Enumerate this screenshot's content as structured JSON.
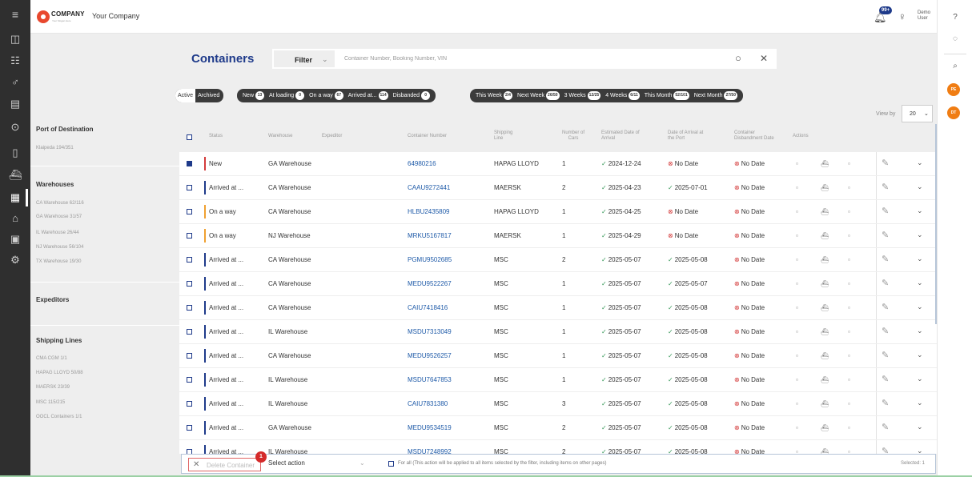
{
  "header": {
    "logo_word": "COMPANY",
    "logo_slogan": "Your Slogan Here",
    "company_name": "Your Company",
    "notification_count": "99+",
    "user_name": "Demo User"
  },
  "page": {
    "title": "Containers"
  },
  "search": {
    "filter_label": "Filter",
    "placeholder": "Container Number, Booking Number, VIN"
  },
  "tabs": {
    "active": "Active",
    "archived": "Archived"
  },
  "status_filters": [
    {
      "label": "New",
      "count": "13"
    },
    {
      "label": "At loading",
      "count": "0"
    },
    {
      "label": "On a way",
      "count": "67"
    },
    {
      "label": "Arrived at...",
      "count": "114"
    },
    {
      "label": "Disbanded",
      "count": "0"
    }
  ],
  "time_filters": [
    {
      "label": "This Week",
      "count": "2/4"
    },
    {
      "label": "Next Week",
      "count": "26/50"
    },
    {
      "label": "3 Weeks",
      "count": "12/25"
    },
    {
      "label": "4 Weeks",
      "count": "6/11"
    },
    {
      "label": "This Month",
      "count": "52/101"
    },
    {
      "label": "Next Month",
      "count": "27/50"
    }
  ],
  "view_by": {
    "label": "View by",
    "value": "20"
  },
  "filters_panel": {
    "port_of_destination": {
      "title": "Port of Destination",
      "items": [
        "Klaipeda 194/351"
      ]
    },
    "warehouses": {
      "title": "Warehouses",
      "items": [
        "CA Warehouse 62/116",
        "GA Warehouse 31/57",
        "IL Warehouse 26/44",
        "NJ Warehouse 56/104",
        "TX Warehouse 19/30"
      ]
    },
    "expeditors": {
      "title": "Expeditors"
    },
    "shipping_lines": {
      "title": "Shipping Lines",
      "items": [
        "CMA CGM 1/1",
        "HAPAG LLOYD 50/88",
        "MAERSK 23/39",
        "MSC 115/215",
        "OOCL Containers 1/1"
      ]
    }
  },
  "table": {
    "headers": {
      "status": "Status",
      "warehouse": "Warehouse",
      "expeditor": "Expeditor",
      "container_number": "Container Number",
      "shipping_line": "Shipping Line",
      "number_of_cars": "Number of Cars",
      "eta": "Estimated Date of Arrival",
      "arrival_at_port": "Date of Arrival at the Port",
      "disbandment": "Container Disbandment Date",
      "actions": "Actions"
    },
    "rows": [
      {
        "selected": true,
        "status": "New",
        "status_color": "#d43b3b",
        "warehouse": "GA Warehouse",
        "container": "64980216",
        "line": "HAPAG LLOYD",
        "cars": "1",
        "eta": "2024-12-24",
        "arrival": "No Date",
        "arrival_ok": false,
        "disband": "No Date"
      },
      {
        "selected": false,
        "status": "Arrived at ...",
        "status_color": "#1e3a8a",
        "warehouse": "CA Warehouse",
        "container": "CAAU9272441",
        "line": "MAERSK",
        "cars": "2",
        "eta": "2025-04-23",
        "arrival": "2025-07-01",
        "arrival_ok": true,
        "disband": "No Date"
      },
      {
        "selected": false,
        "status": "On a way",
        "status_color": "#f0a030",
        "warehouse": "CA Warehouse",
        "container": "HLBU2435809",
        "line": "HAPAG LLOYD",
        "cars": "1",
        "eta": "2025-04-25",
        "arrival": "No Date",
        "arrival_ok": false,
        "disband": "No Date"
      },
      {
        "selected": false,
        "status": "On a way",
        "status_color": "#f0a030",
        "warehouse": "NJ Warehouse",
        "container": "MRKU5167817",
        "line": "MAERSK",
        "cars": "1",
        "eta": "2025-04-29",
        "arrival": "No Date",
        "arrival_ok": false,
        "disband": "No Date"
      },
      {
        "selected": false,
        "status": "Arrived at ...",
        "status_color": "#1e3a8a",
        "warehouse": "CA Warehouse",
        "container": "PGMU9502685",
        "line": "MSC",
        "cars": "2",
        "eta": "2025-05-07",
        "arrival": "2025-05-08",
        "arrival_ok": true,
        "disband": "No Date"
      },
      {
        "selected": false,
        "status": "Arrived at ...",
        "status_color": "#1e3a8a",
        "warehouse": "CA Warehouse",
        "container": "MEDU9522267",
        "line": "MSC",
        "cars": "1",
        "eta": "2025-05-07",
        "arrival": "2025-05-07",
        "arrival_ok": true,
        "disband": "No Date"
      },
      {
        "selected": false,
        "status": "Arrived at ...",
        "status_color": "#1e3a8a",
        "warehouse": "CA Warehouse",
        "container": "CAIU7418416",
        "line": "MSC",
        "cars": "1",
        "eta": "2025-05-07",
        "arrival": "2025-05-08",
        "arrival_ok": true,
        "disband": "No Date"
      },
      {
        "selected": false,
        "status": "Arrived at ...",
        "status_color": "#1e3a8a",
        "warehouse": "IL Warehouse",
        "container": "MSDU7313049",
        "line": "MSC",
        "cars": "1",
        "eta": "2025-05-07",
        "arrival": "2025-05-08",
        "arrival_ok": true,
        "disband": "No Date"
      },
      {
        "selected": false,
        "status": "Arrived at ...",
        "status_color": "#1e3a8a",
        "warehouse": "CA Warehouse",
        "container": "MEDU9526257",
        "line": "MSC",
        "cars": "1",
        "eta": "2025-05-07",
        "arrival": "2025-05-08",
        "arrival_ok": true,
        "disband": "No Date"
      },
      {
        "selected": false,
        "status": "Arrived at ...",
        "status_color": "#1e3a8a",
        "warehouse": "IL Warehouse",
        "container": "MSDU7647853",
        "line": "MSC",
        "cars": "1",
        "eta": "2025-05-07",
        "arrival": "2025-05-08",
        "arrival_ok": true,
        "disband": "No Date"
      },
      {
        "selected": false,
        "status": "Arrived at ...",
        "status_color": "#1e3a8a",
        "warehouse": "IL Warehouse",
        "container": "CAIU7831380",
        "line": "MSC",
        "cars": "3",
        "eta": "2025-05-07",
        "arrival": "2025-05-08",
        "arrival_ok": true,
        "disband": "No Date"
      },
      {
        "selected": false,
        "status": "Arrived at ...",
        "status_color": "#1e3a8a",
        "warehouse": "GA Warehouse",
        "container": "MEDU9534519",
        "line": "MSC",
        "cars": "2",
        "eta": "2025-05-07",
        "arrival": "2025-05-08",
        "arrival_ok": true,
        "disband": "No Date"
      },
      {
        "selected": false,
        "status": "Arrived at ...",
        "status_color": "#1e3a8a",
        "warehouse": "IL Warehouse",
        "container": "MSDU7248992",
        "line": "MSC",
        "cars": "2",
        "eta": "2025-05-07",
        "arrival": "2025-05-08",
        "arrival_ok": true,
        "disband": "No Date"
      }
    ]
  },
  "bottom_bar": {
    "delete_label": "Delete Container",
    "step_number": "1",
    "select_action": "Select action",
    "for_all_text": "For all (This action will be applied to all items selected by the filter, including items on other pages)",
    "selected_text": "Selected: 1"
  },
  "right_rail": {
    "badge1": "PE",
    "badge2": "DT"
  },
  "icons": {
    "menu": "hamburger-icon",
    "dashboard": "dashboard-icon",
    "list": "list-icon",
    "users": "users-icon",
    "buildings": "buildings-icon",
    "dollar": "dollar-icon",
    "document": "document-icon",
    "ship": "ship-icon",
    "container": "container-icon",
    "warehouse": "warehouse-icon",
    "calculator": "calculator-icon",
    "settings": "gear-icon"
  }
}
